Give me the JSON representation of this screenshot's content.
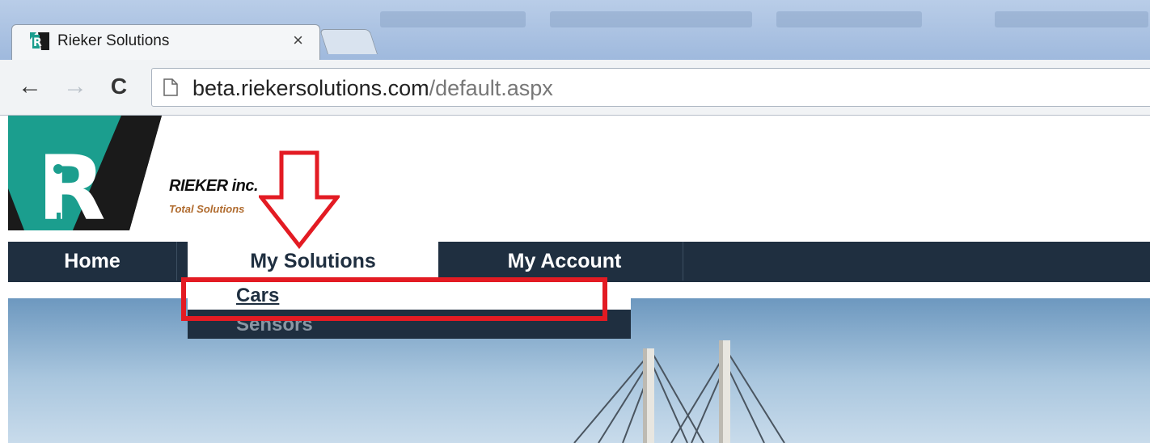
{
  "browser": {
    "tab": {
      "title": "Rieker Solutions",
      "close_glyph": "×"
    },
    "nav": {
      "back_icon": "←",
      "forward_icon": "→",
      "reload_icon": "C"
    },
    "address": {
      "host": "beta.riekersolutions.com",
      "path": "/default.aspx"
    }
  },
  "site": {
    "logo": {
      "letter": "R",
      "colors": {
        "teal": "#1b9e8e",
        "dark": "#1a1a1a"
      }
    },
    "brand_name": "RIEKER inc.",
    "tagline": "Total Solutions",
    "menu": [
      {
        "label": "Home",
        "active": false
      },
      {
        "label": "My Solutions",
        "active": true
      },
      {
        "label": "My Account",
        "active": false
      }
    ],
    "dropdown": [
      {
        "label": "Cars",
        "highlighted": true
      },
      {
        "label": "Sensors",
        "highlighted": false
      }
    ]
  },
  "colors": {
    "menu_bg": "#1f2f40",
    "annotation_red": "#e31b23",
    "tagline": "#b06b2e"
  }
}
